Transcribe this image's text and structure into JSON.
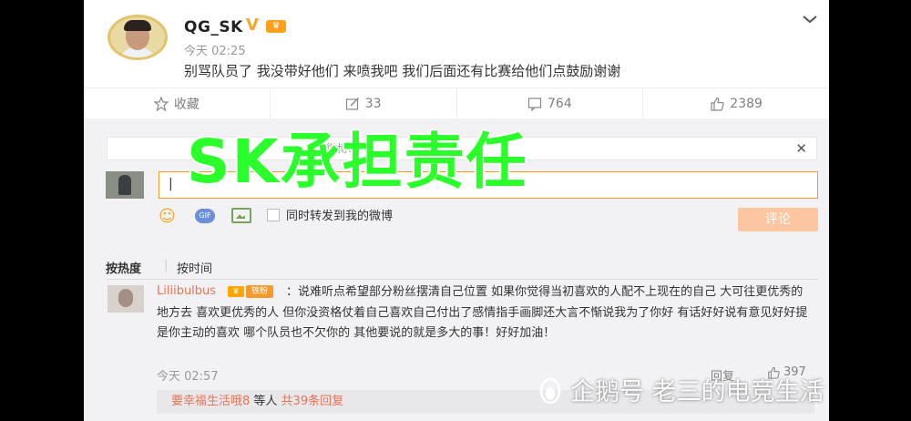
{
  "post": {
    "username": "QG_SK",
    "verified_badge": "V",
    "time": "今天 02:25",
    "text": "别骂队员了 我没带好他们 来喷我吧 我们后面还有比赛给他们点鼓励谢谢"
  },
  "actions": {
    "favorite_label": "收藏",
    "repost_count": "33",
    "comment_count": "764",
    "like_count": "2389"
  },
  "composer": {
    "tip_text": "微博…",
    "input_value": "|",
    "repost_label": "同时转发到我的微博",
    "submit_label": "评论",
    "gif_label": "GIF"
  },
  "sort": {
    "hot_label": "按热度",
    "time_label": "按时间"
  },
  "comment": {
    "username": "Liliibulbus",
    "fan_badge": "铁粉",
    "text": "：说难听点希望部分粉丝摆清自己位置 如果你觉得当初喜欢的人配不上现在的自己 大可往更优秀的地方去 喜欢更优秀的人 但你没资格仗着自己喜欢自己付出了感情指手画脚还大言不惭说我为了你好 有话好好说有意见好好提 是你主动的喜欢 哪个队员也不欠你的 其他要说的就是多大的事！好好加油！",
    "time": "今天 02:57",
    "reply_label": "回复",
    "like_count": "397"
  },
  "sub_reply": {
    "name": "要幸福生活哦8",
    "mid": " 等人 ",
    "count": "共39条回复"
  },
  "overlay_title": "SK承担责任",
  "watermark": "企鹅号 老三的电竞生活",
  "colors": {
    "accent_orange": "#eb7350",
    "overlay_green": "#2bff2b",
    "input_border": "#f59a2b"
  }
}
